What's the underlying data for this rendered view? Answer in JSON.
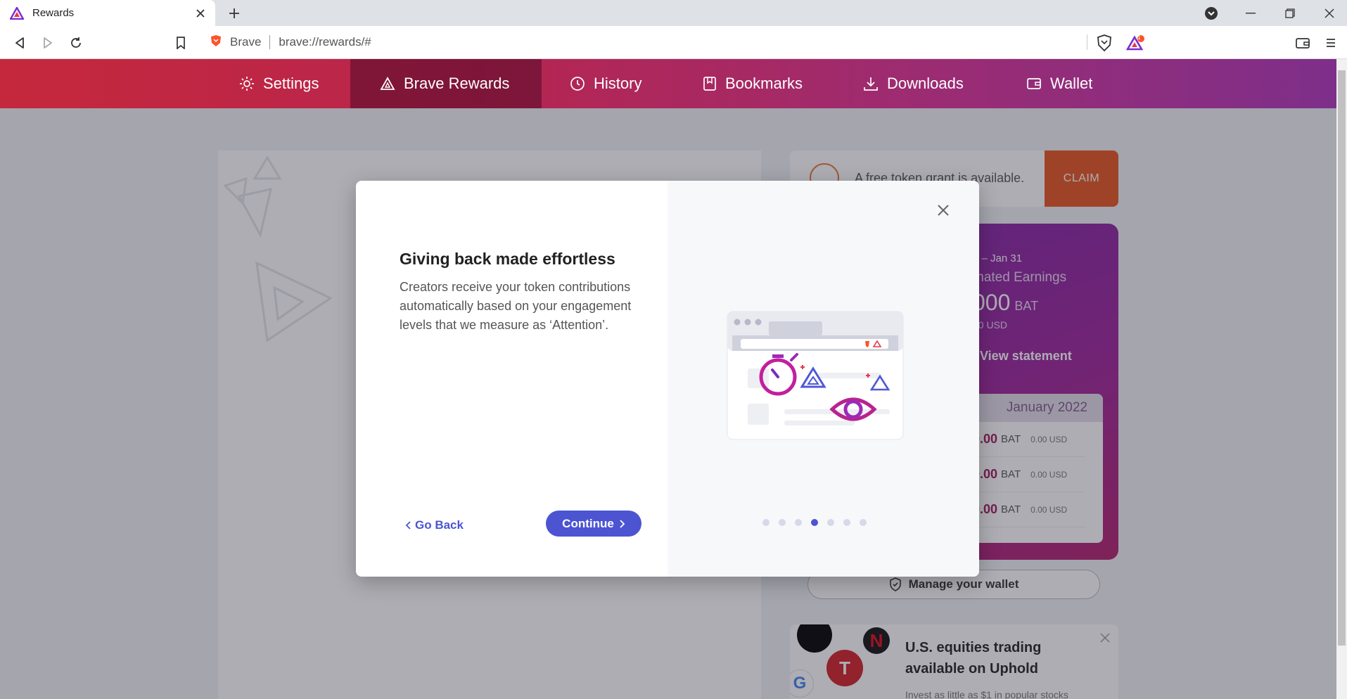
{
  "browser": {
    "tab_title": "Rewards",
    "omnibox_site": "Brave",
    "omnibox_url": "brave://rewards/#",
    "rewards_badge": "1"
  },
  "nav": {
    "items": [
      {
        "label": "Settings",
        "icon": "gear-icon"
      },
      {
        "label": "Brave Rewards",
        "icon": "bat-triangle-icon"
      },
      {
        "label": "History",
        "icon": "clock-icon"
      },
      {
        "label": "Bookmarks",
        "icon": "bookmark-icon"
      },
      {
        "label": "Downloads",
        "icon": "download-icon"
      },
      {
        "label": "Wallet",
        "icon": "wallet-icon"
      }
    ]
  },
  "grant": {
    "text": "A free token grant is available.",
    "claim_label": "CLAIM"
  },
  "earnings": {
    "period": "1 – Jan 31",
    "label": "mated Earnings",
    "amount": "000",
    "unit": "BAT",
    "usd": "00 USD",
    "statement_label": "View statement",
    "month": "January 2022",
    "rows": [
      {
        "value": "0.00",
        "unit": "BAT",
        "usd": "0.00 USD"
      },
      {
        "value": "0.00",
        "unit": "BAT",
        "usd": "0.00 USD"
      },
      {
        "value": "0.00",
        "unit": "BAT",
        "usd": "0.00 USD"
      }
    ]
  },
  "manage_wallet_label": "Manage your wallet",
  "uphold": {
    "heading": "U.S. equities trading available on Uphold",
    "sub": "Invest as little as $1 in popular stocks"
  },
  "modal": {
    "heading": "Giving back made effortless",
    "body": "Creators receive your token contributions automatically based on your engagement levels that we measure as ‘Attention’.",
    "back_label": "Go Back",
    "continue_label": "Continue",
    "dots_total": 7,
    "dots_active": 4
  },
  "colors": {
    "accent": "#4c54d2",
    "brand_red": "#c5283c",
    "brand_purple": "#7e2f8a",
    "claim_orange": "#e9541f"
  }
}
